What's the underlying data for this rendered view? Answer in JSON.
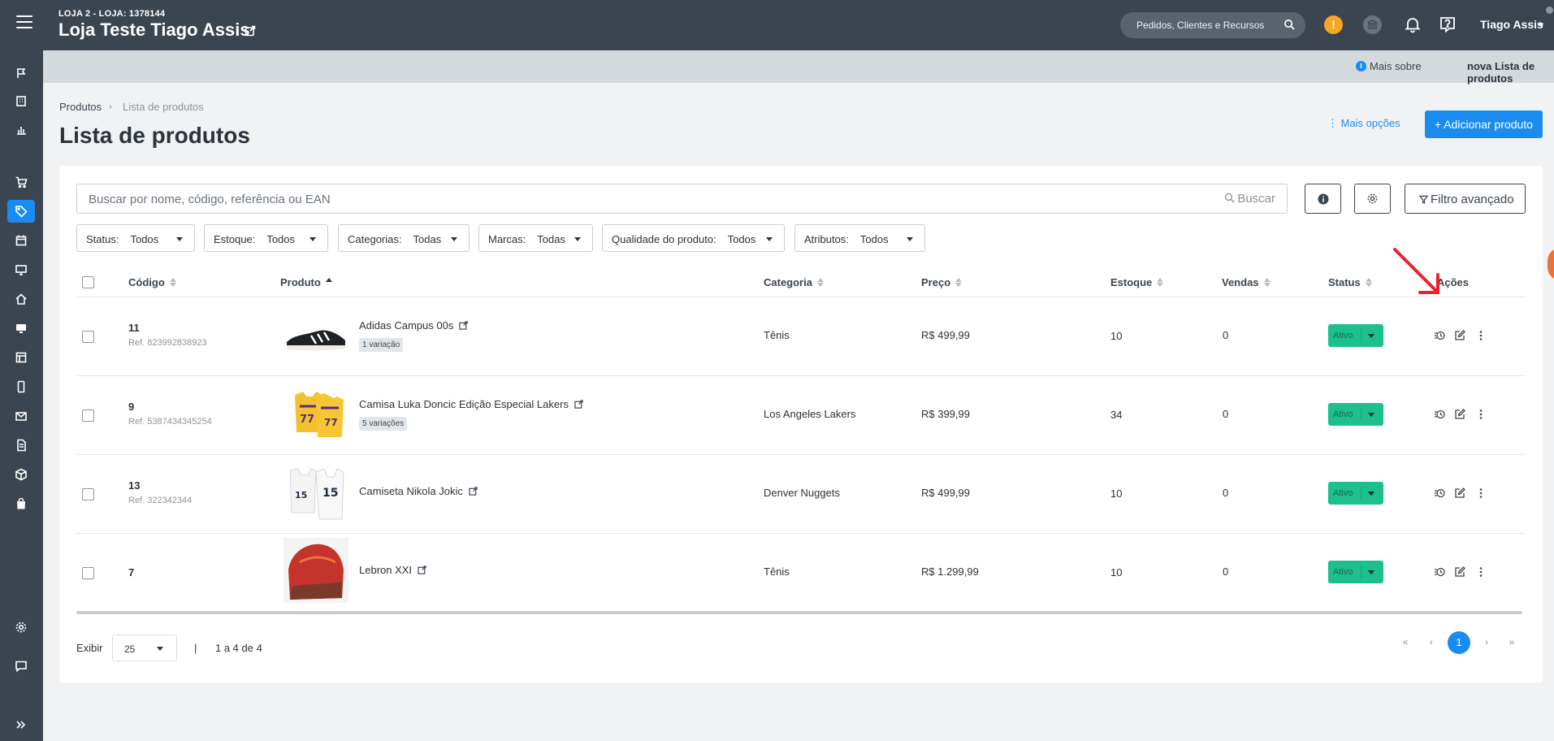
{
  "header": {
    "store_sub": "LOJA 2 - LOJA: 1378144",
    "store_name": "Loja Teste Tiago Assis",
    "search_placeholder": "Pedidos, Clientes e Recursos",
    "warning_badge": "!",
    "user_name": "Tiago Assis"
  },
  "sidebar": {
    "items": [
      "flag-icon",
      "building-icon",
      "chart-icon",
      "cart-icon",
      "tag-icon",
      "calendar-icon",
      "monitor-icon",
      "home-icon",
      "desktop-icon",
      "layout-icon",
      "mobile-icon",
      "mail-icon",
      "document-icon",
      "box-icon",
      "bag-icon",
      "settings-icon",
      "chat-icon",
      "expand-icon"
    ],
    "active": "tag-icon"
  },
  "info_strip": {
    "prefix": "Mais sobre",
    "link": "nova Lista de produtos"
  },
  "breadcrumb": {
    "root": "Produtos",
    "separator": "›",
    "current": "Lista de produtos"
  },
  "page_title": "Lista de produtos",
  "actions": {
    "more_options": "⋮ Mais opções",
    "add_product": "+ Adicionar produto"
  },
  "search": {
    "placeholder": "Buscar por nome, código, referência ou EAN",
    "button": "Buscar",
    "advanced_filter": "Filtro avançado"
  },
  "filters": [
    {
      "label": "Status:",
      "value": "Todos"
    },
    {
      "label": "Estoque:",
      "value": "Todos"
    },
    {
      "label": "Categorias:",
      "value": "Todas"
    },
    {
      "label": "Marcas:",
      "value": "Todas"
    },
    {
      "label": "Qualidade do produto:",
      "value": "Todos"
    },
    {
      "label": "Atributos:",
      "value": "Todos"
    }
  ],
  "table": {
    "columns": [
      "Código",
      "Produto",
      "Categoria",
      "Preço",
      "Estoque",
      "Vendas",
      "Status",
      "Ações"
    ],
    "rows": [
      {
        "code": "11",
        "ref": "Ref. 823992838923",
        "name": "Adidas Campus 00s",
        "variations": "1 variação",
        "category": "Tênis",
        "price": "R$ 499,99",
        "stock": "10",
        "sales": "0",
        "status": "Ativo"
      },
      {
        "code": "9",
        "ref": "Ref. 5387434345254",
        "name": "Camisa Luka Doncic Edição Especial Lakers",
        "variations": "5 variações",
        "category": "Los Angeles Lakers",
        "price": "R$ 399,99",
        "stock": "34",
        "sales": "0",
        "status": "Ativo"
      },
      {
        "code": "13",
        "ref": "Ref. 322342344",
        "name": "Camiseta Nikola Jokic",
        "variations": "",
        "category": "Denver Nuggets",
        "price": "R$ 499,99",
        "stock": "10",
        "sales": "0",
        "status": "Ativo"
      },
      {
        "code": "7",
        "ref": "",
        "name": "Lebron XXI",
        "variations": "",
        "category": "Tênis",
        "price": "R$ 1.299,99",
        "stock": "10",
        "sales": "0",
        "status": "Ativo"
      }
    ]
  },
  "pagination": {
    "show_label": "Exibir",
    "page_size": "25",
    "separator": "|",
    "range": "1 a 4 de 4",
    "first": "«",
    "prev": "‹",
    "current": "1",
    "next": "›",
    "last": "»"
  },
  "colors": {
    "topbar": "#3b4550",
    "accent": "#1a8cf0",
    "status_active": "#1dbf8c",
    "annotation_arrow": "#e8222a"
  }
}
